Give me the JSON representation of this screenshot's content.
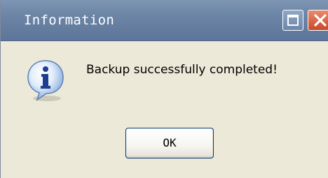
{
  "window": {
    "title": "Information",
    "restore_icon": "restore-icon",
    "close_icon": "close-icon"
  },
  "message": {
    "icon": "info-icon",
    "text": "Backup successfully completed!"
  },
  "buttons": {
    "ok_label": "OK"
  },
  "colors": {
    "titlebar": "#6C84A5",
    "dialog_background": "#ECE9D8",
    "close_button": "#C9492B",
    "button_border": "#003C74"
  }
}
